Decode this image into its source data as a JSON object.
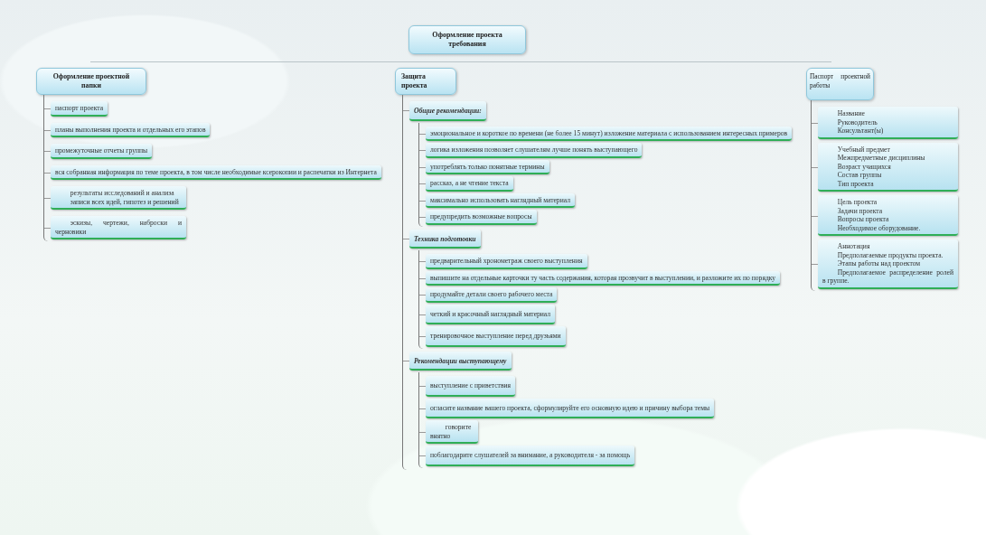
{
  "root": {
    "title": "Оформление проекта требования"
  },
  "branches": [
    {
      "title": "Оформление проектной папки",
      "children": [
        {
          "kind": "leaf",
          "lines": [
            "паспорт проекта"
          ]
        },
        {
          "kind": "leaf",
          "lines": [
            "планы выполнения проекта и отдельных его этапов"
          ]
        },
        {
          "kind": "leaf",
          "lines": [
            "промежуточные отчеты группы"
          ]
        },
        {
          "kind": "leaf",
          "lines": [
            "вся собранная информация по теме проекта, в том числе необходимые ксерокопии и распечатки из Интернета"
          ]
        },
        {
          "kind": "note",
          "lines": [
            "результаты исследований и анализа",
            "записи всех идей, гипотез и решений"
          ]
        },
        {
          "kind": "note",
          "lines": [
            "эскизы, чертежи, наброски и черновики"
          ]
        }
      ]
    },
    {
      "title": "Защита проекта",
      "children": [
        {
          "kind": "group",
          "title": "Общие рекомендации:",
          "children": [
            {
              "kind": "leaf",
              "lines": [
                "эмоциональное и короткое по времени (не более 15 минут) изложение материала с использованием интересных примеров"
              ]
            },
            {
              "kind": "leaf",
              "lines": [
                "логика изложения позволяет слушателям лучше понять выступающего"
              ]
            },
            {
              "kind": "leaf",
              "lines": [
                "употреблять только понятные термины"
              ]
            },
            {
              "kind": "leaf",
              "lines": [
                "рассказ, а не чтение текста"
              ]
            },
            {
              "kind": "leaf",
              "lines": [
                "максимально использовать наглядный материал"
              ]
            },
            {
              "kind": "leaf",
              "lines": [
                "предупредить возможные вопросы"
              ]
            }
          ]
        },
        {
          "kind": "group",
          "title": "Техника подготовки",
          "children": [
            {
              "kind": "leaf",
              "lines": [
                "предварительный хронометраж своего выступления"
              ]
            },
            {
              "kind": "leaf",
              "lines": [
                "выпишите на отдельные карточки ту часть содержания, которая прозвучит в выступлении, и разложите их по порядку"
              ]
            },
            {
              "kind": "leaf",
              "lines": [
                "продумайте детали своего рабочего места"
              ]
            },
            {
              "kind": "tall",
              "lines": [
                "четкий и красочный наглядный материал"
              ]
            },
            {
              "kind": "tall",
              "lines": [
                "тренировочное выступление перед друзьями"
              ]
            }
          ]
        },
        {
          "kind": "group",
          "title": "Рекомендации выступающему",
          "children": [
            {
              "kind": "tall",
              "lines": [
                "выступление с приветствия"
              ]
            },
            {
              "kind": "tall",
              "lines": [
                "огласите название вашего проекта, сформулируйте его основную идею и причину выбора темы"
              ]
            },
            {
              "kind": "note",
              "lines": [
                "говорите внятно"
              ]
            },
            {
              "kind": "tall",
              "lines": [
                "поблагодарите слушателей за внимание, а руководителя - за помощь"
              ]
            }
          ]
        }
      ]
    },
    {
      "title": "Паспорт проектной работы",
      "children": [
        {
          "kind": "note",
          "lines": [
            "Название",
            "Руководитель",
            "Консультант(ы)"
          ]
        },
        {
          "kind": "note",
          "lines": [
            "Учебный предмет",
            "Межпредметные дисциплины",
            "Возраст учащихся",
            "Состав группы",
            "Тип проекта"
          ]
        },
        {
          "kind": "note",
          "lines": [
            "Цель проекта",
            "Задачи проекта",
            "Вопросы проекта",
            "Необходимое оборудование."
          ]
        },
        {
          "kind": "note",
          "lines": [
            "Аннотация",
            "Предполагаемые продукты проекта.",
            "Этапы работы над проектом",
            "Предполагаемое распределение ролей в группе."
          ]
        }
      ]
    }
  ]
}
